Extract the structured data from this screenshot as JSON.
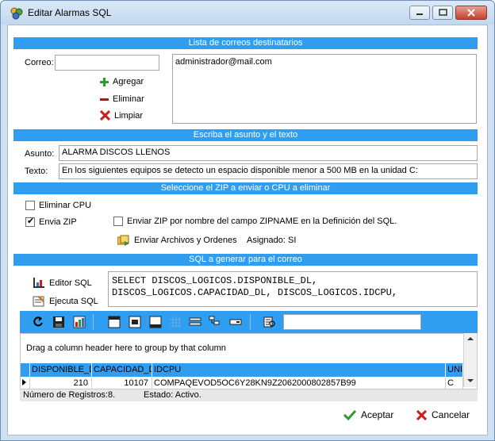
{
  "window": {
    "title": "Editar Alarmas SQL"
  },
  "sections": {
    "emails": "Lista de correos destinatarios",
    "subject": "Escriba el asunto y el texto",
    "zip": "Seleccione el ZIP a enviar o CPU a eliminar",
    "sql": "SQL a generar para el correo"
  },
  "emails": {
    "correo_label": "Correo:",
    "correo_value": "",
    "add_label": "Agregar",
    "remove_label": "Eliminar",
    "clear_label": "Limpiar",
    "list": [
      "administrador@mail.com"
    ]
  },
  "message": {
    "asunto_label": "Asunto:",
    "asunto_value": "ALARMA DISCOS LLENOS",
    "texto_label": "Texto:",
    "texto_value": "En los siguientes equipos se detecto un espacio disponible menor a 500 MB en la unidad C:"
  },
  "options": {
    "eliminar_cpu": "Eliminar CPU",
    "envia_zip": "Envia ZIP",
    "zip_by_name": "Enviar ZIP por nombre del campo ZIPNAME en la Definición del SQL.",
    "send_files": "Enviar Archivos y Ordenes",
    "assigned": "Asignado: SI"
  },
  "sql": {
    "editor_label": "Editor SQL",
    "execute_label": "Ejecuta SQL",
    "text": "SELECT DISCOS_LOGICOS.DISPONIBLE_DL,\nDISCOS_LOGICOS.CAPACIDAD_DL, DISCOS_LOGICOS.IDCPU,"
  },
  "grid": {
    "group_hint": "Drag a column header here to group by that column",
    "search_value": "",
    "columns": [
      "DISPONIBLE_D",
      "CAPACIDAD_D",
      "IDCPU",
      "UNI"
    ],
    "rows": [
      [
        "210",
        "10107",
        "COMPAQEVOD5OC6Y28KN9Z2062000802857B99",
        "C"
      ]
    ],
    "record_count": "Número de Registros:8.",
    "state": "Estado: Activo."
  },
  "footer": {
    "accept": "Aceptar",
    "cancel": "Cancelar"
  },
  "colors": {
    "accent": "#2f9ef0",
    "window_frame": "#cfe0f1",
    "accept_green": "#2e9b2e",
    "cancel_red": "#c8201a"
  },
  "icons": [
    "app-icon",
    "minimize-icon",
    "maximize-icon",
    "close-icon",
    "plus-icon",
    "minus-icon",
    "x-icon",
    "files-icon",
    "sql-editor-icon",
    "sql-run-icon",
    "refresh-icon",
    "save-icon",
    "chart-icon",
    "layout-icon",
    "check-icon",
    "cross-icon"
  ]
}
